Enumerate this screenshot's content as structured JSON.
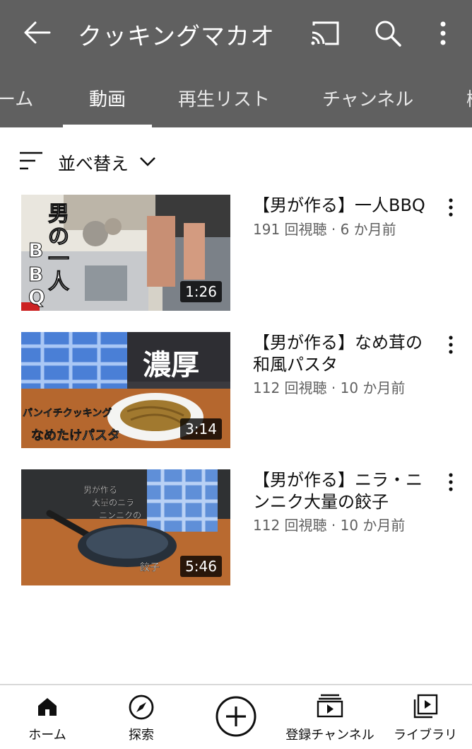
{
  "appbar": {
    "title": "クッキングマカオ",
    "icons": [
      "back-arrow-icon",
      "cast-icon",
      "search-icon",
      "more-vert-icon"
    ]
  },
  "tabs": [
    {
      "label": "ーム"
    },
    {
      "label": "動画",
      "active": true
    },
    {
      "label": "再生リスト"
    },
    {
      "label": "チャンネル"
    },
    {
      "label": "概"
    }
  ],
  "sort": {
    "label": "並べ替え"
  },
  "videos": [
    {
      "title": "【男が作る】一人BBQ",
      "meta": "191 回視聴 · 6 か月前",
      "duration": "1:26",
      "thumb_text": [
        "男",
        "の",
        "一",
        "人",
        "B",
        "B",
        "Q"
      ]
    },
    {
      "title": "【男が作る】なめ茸の和風パスタ",
      "meta": "112 回視聴 · 10 か月前",
      "duration": "3:14",
      "thumb_text": [
        "濃厚",
        "パンイチクッキング",
        "なめたけパスタ"
      ]
    },
    {
      "title": "【男が作る】ニラ・ニンニク大量の餃子",
      "meta": "112 回視聴 · 10 か月前",
      "duration": "5:46",
      "thumb_text": [
        "男が作る",
        "大量のニラ",
        "ニンニクの",
        "餃子"
      ]
    }
  ],
  "bottomnav": [
    {
      "label": "ホーム",
      "icon": "home-icon"
    },
    {
      "label": "探索",
      "icon": "explore-icon"
    },
    {
      "label": "",
      "icon": "create-icon"
    },
    {
      "label": "登録チャンネル",
      "icon": "subscriptions-icon"
    },
    {
      "label": "ライブラリ",
      "icon": "library-icon"
    }
  ],
  "colors": {
    "appbar": "#606060",
    "text": "#0f0f0f",
    "meta": "#606060"
  }
}
